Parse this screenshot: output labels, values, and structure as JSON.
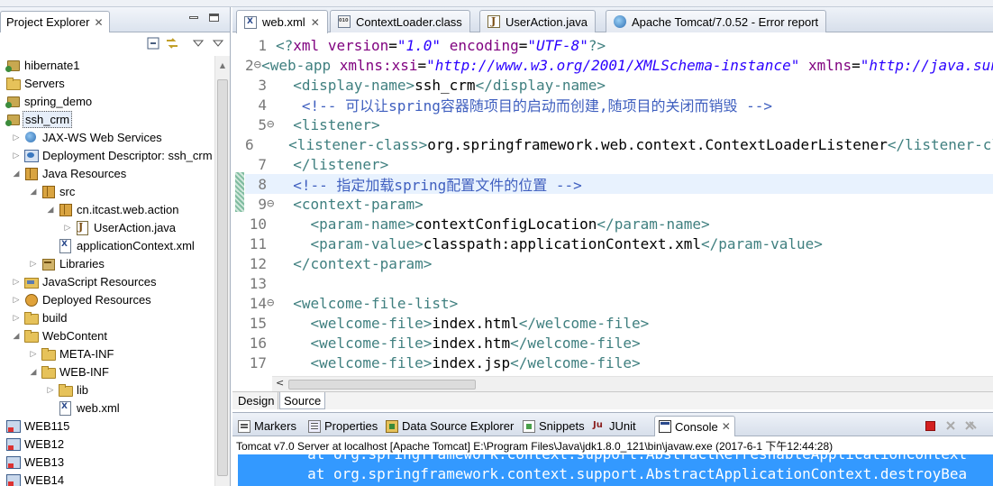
{
  "explorer": {
    "tab_label": "Project Explorer",
    "tree": [
      {
        "label": "hibernate1",
        "icon": "project-icon",
        "depth": 0,
        "twisty": ""
      },
      {
        "label": "Servers",
        "icon": "folder-icon",
        "depth": 0,
        "twisty": ""
      },
      {
        "label": "spring_demo",
        "icon": "project-icon",
        "depth": 0,
        "twisty": ""
      },
      {
        "label": "ssh_crm",
        "icon": "project-icon",
        "depth": 0,
        "twisty": "",
        "selected": true
      },
      {
        "label": "JAX-WS Web Services",
        "icon": "web-services-icon",
        "depth": 1,
        "twisty": "▷"
      },
      {
        "label": "Deployment Descriptor: ssh_crm",
        "icon": "descriptor-icon",
        "depth": 1,
        "twisty": "▷"
      },
      {
        "label": "Java Resources",
        "icon": "java-resources-icon",
        "depth": 1,
        "twisty": "◢"
      },
      {
        "label": "src",
        "icon": "source-folder-icon",
        "depth": 2,
        "twisty": "◢"
      },
      {
        "label": "cn.itcast.web.action",
        "icon": "package-icon",
        "depth": 3,
        "twisty": "◢"
      },
      {
        "label": "UserAction.java",
        "icon": "java-file-icon",
        "depth": 4,
        "twisty": "▷"
      },
      {
        "label": "applicationContext.xml",
        "icon": "xml-file-icon",
        "depth": 3,
        "twisty": ""
      },
      {
        "label": "Libraries",
        "icon": "library-icon",
        "depth": 2,
        "twisty": "▷"
      },
      {
        "label": "JavaScript Resources",
        "icon": "javascript-resources-icon",
        "depth": 1,
        "twisty": "▷"
      },
      {
        "label": "Deployed Resources",
        "icon": "deployed-resources-icon",
        "depth": 1,
        "twisty": "▷"
      },
      {
        "label": "build",
        "icon": "folder-icon",
        "depth": 1,
        "twisty": "▷"
      },
      {
        "label": "WebContent",
        "icon": "folder-icon",
        "depth": 1,
        "twisty": "◢"
      },
      {
        "label": "META-INF",
        "icon": "folder-icon",
        "depth": 2,
        "twisty": "▷"
      },
      {
        "label": "WEB-INF",
        "icon": "folder-icon",
        "depth": 2,
        "twisty": "◢"
      },
      {
        "label": "lib",
        "icon": "folder-icon",
        "depth": 3,
        "twisty": "▷"
      },
      {
        "label": "web.xml",
        "icon": "xml-file-icon",
        "depth": 3,
        "twisty": ""
      },
      {
        "label": "WEB115",
        "icon": "web-project-icon",
        "depth": 0,
        "twisty": ""
      },
      {
        "label": "WEB12",
        "icon": "web-project-icon",
        "depth": 0,
        "twisty": ""
      },
      {
        "label": "WEB13",
        "icon": "web-project-icon",
        "depth": 0,
        "twisty": ""
      },
      {
        "label": "WEB14",
        "icon": "web-project-icon",
        "depth": 0,
        "twisty": ""
      }
    ]
  },
  "editor": {
    "tabs": [
      {
        "label": "web.xml",
        "icon": "xml-file-icon",
        "active": true,
        "closable": true
      },
      {
        "label": "ContextLoader.class",
        "icon": "class-file-icon",
        "active": false,
        "closable": false
      },
      {
        "label": "UserAction.java",
        "icon": "java-file-icon",
        "active": false,
        "closable": false
      },
      {
        "label": "Apache Tomcat/7.0.52 - Error report",
        "icon": "globe-icon",
        "active": false,
        "closable": false
      }
    ],
    "lines": [
      {
        "num": "1",
        "fold": "",
        "tokens": [
          [
            "tag",
            "<?"
          ],
          [
            "attr",
            "xml"
          ],
          [
            "txt",
            " "
          ],
          [
            "attr",
            "version"
          ],
          [
            "txt",
            "="
          ],
          [
            "str",
            "\"1.0\""
          ],
          [
            "txt",
            " "
          ],
          [
            "attr",
            "encoding"
          ],
          [
            "txt",
            "="
          ],
          [
            "str",
            "\"UTF-8\""
          ],
          [
            "tag",
            "?>"
          ]
        ]
      },
      {
        "num": "2",
        "fold": "⊖",
        "tokens": [
          [
            "tag",
            "<web-app"
          ],
          [
            "txt",
            " "
          ],
          [
            "attr",
            "xmlns:xsi"
          ],
          [
            "txt",
            "="
          ],
          [
            "str",
            "\"http://www.w3.org/2001/XMLSchema-instance\""
          ],
          [
            "txt",
            " "
          ],
          [
            "attr",
            "xmlns"
          ],
          [
            "txt",
            "="
          ],
          [
            "str",
            "\"http://java.sun.com/xml/ns/javaee\""
          ]
        ]
      },
      {
        "num": "3",
        "fold": "",
        "tokens": [
          [
            "txt",
            "  "
          ],
          [
            "tag",
            "<display-name>"
          ],
          [
            "txt",
            "ssh_crm"
          ],
          [
            "tag",
            "</display-name>"
          ]
        ]
      },
      {
        "num": "4",
        "fold": "",
        "tokens": [
          [
            "txt",
            "   "
          ],
          [
            "cmt",
            "<!-- 可以让spring容器随项目的启动而创建,随项目的关闭而销毁 -->"
          ]
        ]
      },
      {
        "num": "5",
        "fold": "⊖",
        "tokens": [
          [
            "txt",
            "  "
          ],
          [
            "tag",
            "<listener>"
          ]
        ]
      },
      {
        "num": "6",
        "fold": "",
        "tokens": [
          [
            "txt",
            "    "
          ],
          [
            "tag",
            "<listener-class>"
          ],
          [
            "txt",
            "org.springframework.web.context.ContextLoaderListener"
          ],
          [
            "tag",
            "</listener-class>"
          ]
        ]
      },
      {
        "num": "7",
        "fold": "",
        "tokens": [
          [
            "txt",
            "  "
          ],
          [
            "tag",
            "</listener>"
          ]
        ]
      },
      {
        "num": "8",
        "fold": "",
        "current": true,
        "tokens": [
          [
            "txt",
            "  "
          ],
          [
            "cmt",
            "<!-- 指定加载spring配置文件的位置 -->"
          ]
        ]
      },
      {
        "num": "9",
        "fold": "⊖",
        "tokens": [
          [
            "txt",
            "  "
          ],
          [
            "tag",
            "<context-param>"
          ]
        ]
      },
      {
        "num": "10",
        "fold": "",
        "tokens": [
          [
            "txt",
            "    "
          ],
          [
            "tag",
            "<param-name>"
          ],
          [
            "txt",
            "contextConfigLocation"
          ],
          [
            "tag",
            "</param-name>"
          ]
        ]
      },
      {
        "num": "11",
        "fold": "",
        "tokens": [
          [
            "txt",
            "    "
          ],
          [
            "tag",
            "<param-value>"
          ],
          [
            "txt",
            "classpath:applicationContext.xml"
          ],
          [
            "tag",
            "</param-value>"
          ]
        ]
      },
      {
        "num": "12",
        "fold": "",
        "tokens": [
          [
            "txt",
            "  "
          ],
          [
            "tag",
            "</context-param>"
          ]
        ]
      },
      {
        "num": "13",
        "fold": "",
        "tokens": []
      },
      {
        "num": "14",
        "fold": "⊖",
        "tokens": [
          [
            "txt",
            "  "
          ],
          [
            "tag",
            "<welcome-file-list>"
          ]
        ]
      },
      {
        "num": "15",
        "fold": "",
        "tokens": [
          [
            "txt",
            "    "
          ],
          [
            "tag",
            "<welcome-file>"
          ],
          [
            "txt",
            "index.html"
          ],
          [
            "tag",
            "</welcome-file>"
          ]
        ]
      },
      {
        "num": "16",
        "fold": "",
        "tokens": [
          [
            "txt",
            "    "
          ],
          [
            "tag",
            "<welcome-file>"
          ],
          [
            "txt",
            "index.htm"
          ],
          [
            "tag",
            "</welcome-file>"
          ]
        ]
      },
      {
        "num": "17",
        "fold": "",
        "tokens": [
          [
            "txt",
            "    "
          ],
          [
            "tag",
            "<welcome-file>"
          ],
          [
            "txt",
            "index.jsp"
          ],
          [
            "tag",
            "</welcome-file>"
          ]
        ]
      }
    ],
    "bottom_tabs": [
      {
        "label": "Design",
        "active": false
      },
      {
        "label": "Source",
        "active": true
      }
    ],
    "scroll_left_arrow": "<"
  },
  "console": {
    "tabs": [
      {
        "label": "Markers",
        "icon": "markers-icon",
        "active": false
      },
      {
        "label": "Properties",
        "icon": "properties-icon",
        "active": false
      },
      {
        "label": "Data Source Explorer",
        "icon": "data-source-icon",
        "active": false
      },
      {
        "label": "Snippets",
        "icon": "snippets-icon",
        "active": false
      },
      {
        "label": "JUnit",
        "icon": "junit-icon",
        "active": false
      },
      {
        "label": "Console",
        "icon": "console-icon",
        "active": true,
        "closable": true
      }
    ],
    "header": "Tomcat v7.0 Server at localhost [Apache Tomcat] E:\\Program Files\\Java\\jdk1.8.0_121\\bin\\javaw.exe (2017-6-1 下午12:44:28)",
    "output": [
      "        at org.springframework.context.support.AbstractRefreshableApplicationContext",
      "        at org.springframework.context.support.AbstractApplicationContext.destroyBea"
    ]
  },
  "colors": {
    "tag": "#3f7f7f",
    "attribute": "#7f007f",
    "string": "#2a00ff",
    "comment": "#3f5fbf",
    "selection": "#3399ff",
    "current_line": "#e8f2fe"
  }
}
